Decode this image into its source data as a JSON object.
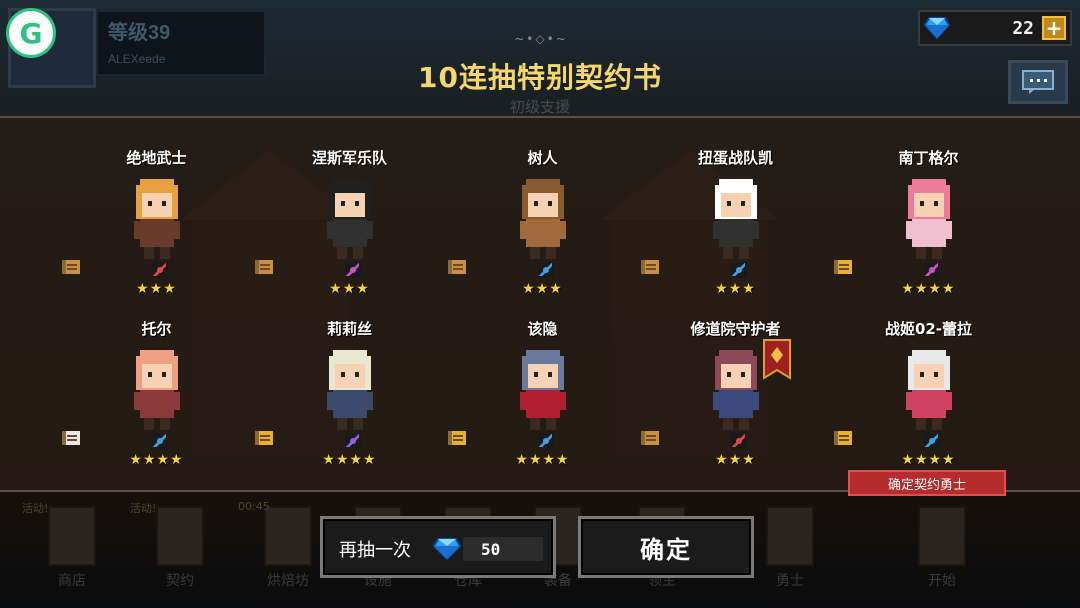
{
  "header": {
    "level": "等级39",
    "player_name": "ALEXeede",
    "gems": "22",
    "ornament": "~•◇•~",
    "title": "10连抽特别契约书",
    "subtitle": "初级支援"
  },
  "cards": [
    {
      "name": "绝地武士",
      "stars": "★★★",
      "class_icon": "sword-icon",
      "class_color": "#e04848",
      "scroll_color": "#c89040",
      "hair": "#e8a040",
      "body": "#6a3a2a"
    },
    {
      "name": "涅斯军乐队",
      "stars": "★★★",
      "class_icon": "potion-icon",
      "class_color": "#d050c0",
      "scroll_color": "#c89040",
      "hair": "#202020",
      "body": "#303030"
    },
    {
      "name": "树人",
      "stars": "★★★",
      "class_icon": "bird-icon",
      "class_color": "#40a0e0",
      "scroll_color": "#c89040",
      "hair": "#8a5a30",
      "body": "#a06a3a"
    },
    {
      "name": "扭蛋战队凯",
      "stars": "★★★",
      "class_icon": "bird-icon",
      "class_color": "#40a0e0",
      "scroll_color": "#c89040",
      "hair": "#ffffff",
      "body": "#303030"
    },
    {
      "name": "南丁格尔",
      "stars": "★★★★",
      "class_icon": "potion-icon",
      "class_color": "#d050c0",
      "scroll_color": "#e8b030",
      "hair": "#f07a9a",
      "body": "#f0c0d0"
    },
    {
      "name": "托尔",
      "stars": "★★★★",
      "class_icon": "bird-icon",
      "class_color": "#40a0e0",
      "scroll_color": "#e8e8e8",
      "hair": "#f0a080",
      "body": "#8a3a3a"
    },
    {
      "name": "莉莉丝",
      "stars": "★★★★",
      "class_icon": "staff-icon",
      "class_color": "#9060e0",
      "scroll_color": "#e8b030",
      "hair": "#e8e8d0",
      "body": "#3a4a6a"
    },
    {
      "name": "该隐",
      "stars": "★★★★",
      "class_icon": "bird-icon",
      "class_color": "#40a0e0",
      "scroll_color": "#e8b030",
      "hair": "#6a7a9a",
      "body": "#b02030"
    },
    {
      "name": "修道院守护者",
      "stars": "★★★",
      "class_icon": "sword-icon",
      "class_color": "#e04848",
      "scroll_color": "#c89040",
      "hair": "#8a4a5a",
      "body": "#3a4a7a"
    },
    {
      "name": "战姬02-蕾拉",
      "stars": "★★★★",
      "class_icon": "bird-icon",
      "class_color": "#40a0e0",
      "scroll_color": "#e8b030",
      "hair": "#e8e8e8",
      "body": "#d04060"
    }
  ],
  "confirm_badge": "确定契约勇士",
  "nav": [
    {
      "label": "商店",
      "badge": "活动!"
    },
    {
      "label": "契约",
      "badge": "活动!"
    },
    {
      "label": "烘焙坊",
      "badge": "00:45"
    },
    {
      "label": "设施",
      "badge": ""
    },
    {
      "label": "仓库",
      "badge": ""
    },
    {
      "label": "装备",
      "badge": ""
    },
    {
      "label": "领主",
      "badge": ""
    },
    {
      "label": "勇士",
      "badge": ""
    },
    {
      "label": "开始",
      "badge": ""
    }
  ],
  "buttons": {
    "again_label": "再抽一次",
    "again_cost": "50",
    "confirm_label": "确定"
  },
  "colors": {
    "title": "#f5d76e",
    "star": "#f7d23a",
    "badge_red": "#b62b2b",
    "gem_blue": "#2aa0f0"
  }
}
